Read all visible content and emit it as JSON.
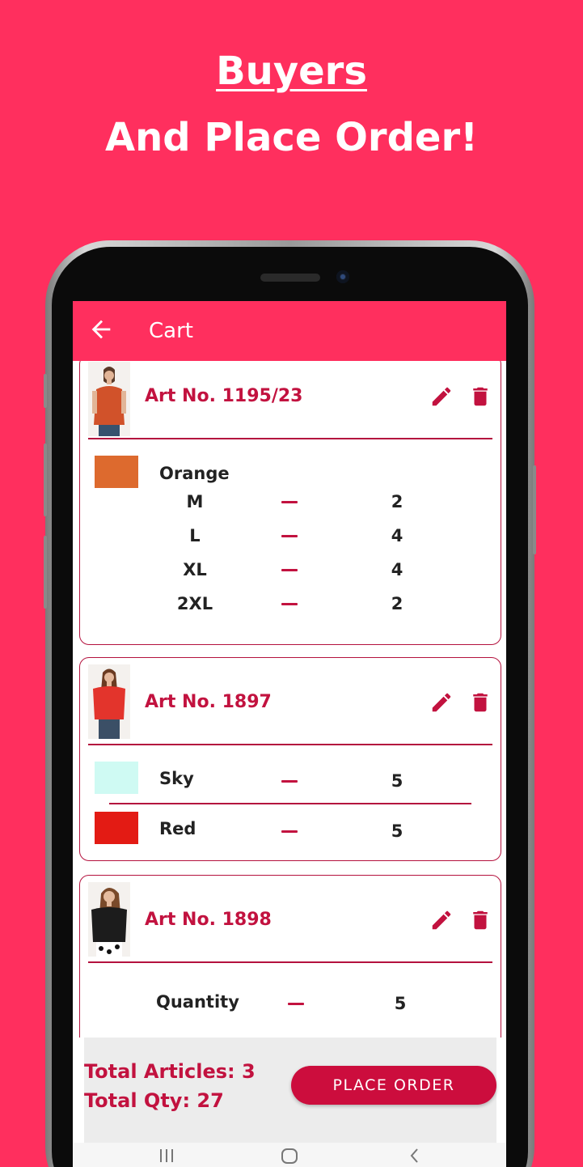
{
  "headline": {
    "line1": "Buyers",
    "line2": "And Place Order!"
  },
  "appbar": {
    "title": "Cart"
  },
  "colors": {
    "brand": "#ff2f5e",
    "accent": "#c2123f",
    "button": "#cc0d3d"
  },
  "cart": {
    "items": [
      {
        "art_no": "Art No. 1195/23",
        "color": {
          "name": "Orange",
          "swatch": "#dd6a2e"
        },
        "sizes": [
          {
            "size": "M",
            "qty": "2"
          },
          {
            "size": "L",
            "qty": "4"
          },
          {
            "size": "XL",
            "qty": "4"
          },
          {
            "size": "2XL",
            "qty": "2"
          }
        ]
      },
      {
        "art_no": "Art No. 1897",
        "colors": [
          {
            "name": "Sky",
            "swatch": "#cffaf3",
            "qty": "5"
          },
          {
            "name": "Red",
            "swatch": "#e31b14",
            "qty": "5"
          }
        ]
      },
      {
        "art_no": "Art No. 1898",
        "quantity_label": "Quantity",
        "qty": "5"
      }
    ]
  },
  "footer": {
    "total_articles": "Total Articles: 3",
    "total_qty": "Total Qty: 27",
    "place_order": "PLACE ORDER"
  },
  "icons": {
    "back": "arrow-left-icon",
    "edit": "pencil-icon",
    "delete": "trash-icon",
    "recents": "recents-icon",
    "home": "home-icon",
    "nav_back": "chevron-left-icon"
  }
}
